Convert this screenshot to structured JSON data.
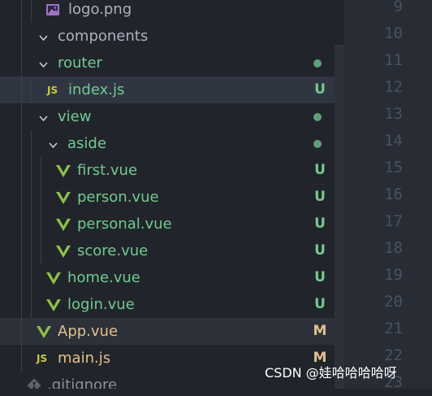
{
  "colors": {
    "sidebar_bg": "#21252b",
    "editor_bg": "#282c34",
    "untracked_green": "#73c991",
    "modified_yellow": "#e2c08d",
    "vue_icon_green": "#8dc149",
    "js_icon_yellow": "#cbcb41",
    "line_number": "#495162"
  },
  "explorer": {
    "items": [
      {
        "label": "logo.png",
        "kind": "file",
        "icon": "image-icon",
        "badge": ""
      },
      {
        "label": "components",
        "kind": "folder",
        "expanded": true,
        "badge": ""
      },
      {
        "label": "router",
        "kind": "folder",
        "expanded": true,
        "decoration": "dot",
        "badge": ""
      },
      {
        "label": "index.js",
        "kind": "file",
        "icon": "js-icon",
        "icon_text": "JS",
        "badge": "U",
        "state": "selected"
      },
      {
        "label": "view",
        "kind": "folder",
        "expanded": true,
        "decoration": "dot",
        "badge": ""
      },
      {
        "label": "aside",
        "kind": "folder",
        "expanded": true,
        "decoration": "dot",
        "badge": ""
      },
      {
        "label": "first.vue",
        "kind": "file",
        "icon": "vue-icon",
        "badge": "U"
      },
      {
        "label": "person.vue",
        "kind": "file",
        "icon": "vue-icon",
        "badge": "U"
      },
      {
        "label": "personal.vue",
        "kind": "file",
        "icon": "vue-icon",
        "badge": "U"
      },
      {
        "label": "score.vue",
        "kind": "file",
        "icon": "vue-icon",
        "badge": "U"
      },
      {
        "label": "home.vue",
        "kind": "file",
        "icon": "vue-icon",
        "badge": "U"
      },
      {
        "label": "login.vue",
        "kind": "file",
        "icon": "vue-icon",
        "badge": "U"
      },
      {
        "label": "App.vue",
        "kind": "file",
        "icon": "vue-icon",
        "badge": "M",
        "state": "active"
      },
      {
        "label": "main.js",
        "kind": "file",
        "icon": "js-icon",
        "icon_text": "JS",
        "badge": "M"
      },
      {
        "label": ".gitignore",
        "kind": "file",
        "icon": "git-icon",
        "badge": ""
      }
    ]
  },
  "editor": {
    "line_numbers": [
      "9",
      "10",
      "11",
      "12",
      "13",
      "14",
      "15",
      "16",
      "17",
      "18",
      "19",
      "20",
      "21",
      "22",
      "23"
    ]
  },
  "watermark": "CSDN @娃哈哈哈哈呀"
}
